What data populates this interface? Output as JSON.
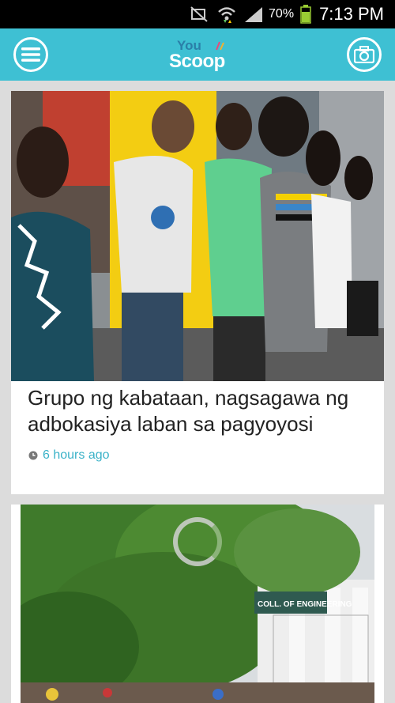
{
  "status_bar": {
    "battery_percent": "70%",
    "time": "7:13 PM",
    "icons": [
      "mute-icon",
      "wifi-icon",
      "signal-icon",
      "battery-icon"
    ]
  },
  "header": {
    "logo_top": "You",
    "logo_bottom": "Scoop",
    "left_icon": "menu-icon",
    "right_icon": "camera-icon",
    "accent_color": "#3ec0d3"
  },
  "feed": {
    "items": [
      {
        "headline": "Grupo ng kabataan, nagsagawa ng adbokasiya laban sa pagyoyosi",
        "time_ago": "6 hours ago"
      }
    ],
    "second_item_loading": true,
    "second_item_sign": "COLL. OF ENGINEERING"
  }
}
